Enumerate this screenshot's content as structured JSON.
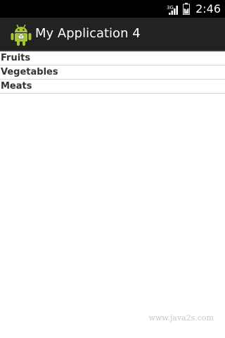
{
  "status_bar": {
    "network_type": "3G",
    "time": "2:46"
  },
  "action_bar": {
    "icon": "android-icon",
    "title": "My Application 4"
  },
  "list": {
    "items": [
      "Fruits",
      "Vegetables",
      "Meats"
    ]
  },
  "watermark": "www.java2s.com",
  "colors": {
    "status_bar": "#000000",
    "action_bar": "#222222",
    "android_green": "#a4c639",
    "background": "#ffffff",
    "divider": "#d6d6d6"
  }
}
